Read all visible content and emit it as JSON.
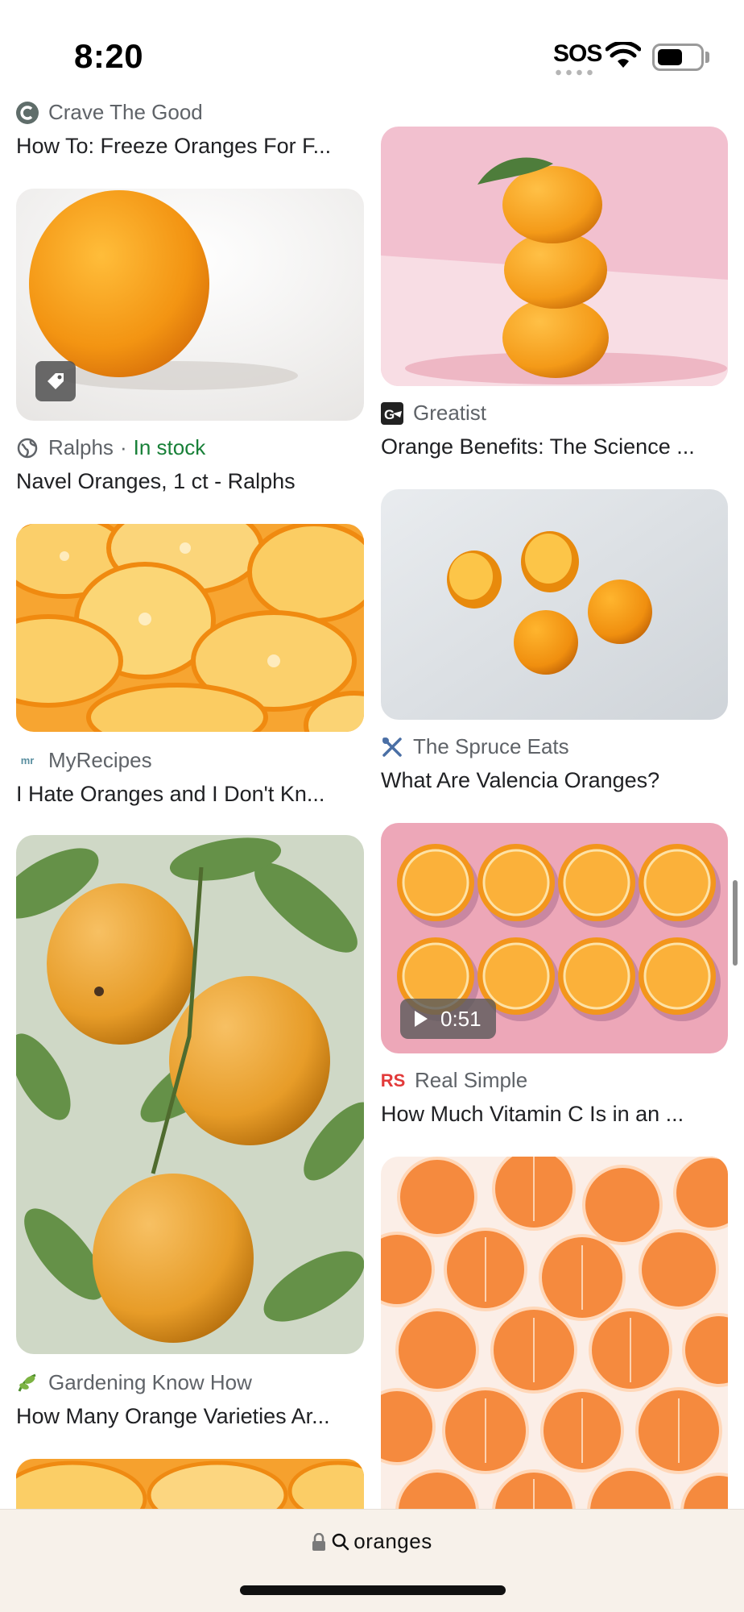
{
  "status_bar": {
    "time": "8:20",
    "sos": "SOS",
    "wifi_icon": "wifi-icon",
    "battery_icon": "battery-icon"
  },
  "results": {
    "left": [
      {
        "source": "Crave The Good",
        "title": "How To: Freeze Oranges For F...",
        "icon": "crave-the-good-logo"
      },
      {
        "source": "Ralphs",
        "separator": "·",
        "stock": "In stock",
        "title": "Navel Oranges, 1 ct - Ralphs",
        "icon": "globe-icon",
        "badge_icon": "tag-icon"
      },
      {
        "source": "MyRecipes",
        "title": "I Hate Oranges and I Don't Kn...",
        "icon": "myrecipes-logo"
      },
      {
        "source": "Gardening Know How",
        "title": "How Many Orange Varieties Ar...",
        "icon": "gardening-know-how-logo"
      }
    ],
    "right": [
      {
        "source": "Greatist",
        "title": "Orange Benefits: The Science ...",
        "icon": "greatist-logo"
      },
      {
        "source": "The Spruce Eats",
        "title": "What Are Valencia Oranges?",
        "icon": "spruce-eats-logo"
      },
      {
        "source": "Real Simple",
        "title": "How Much Vitamin C Is in an ...",
        "icon": "real-simple-logo",
        "logo_text": "RS",
        "video_duration": "0:51",
        "video_icon": "play-icon"
      }
    ]
  },
  "address_bar": {
    "query": "oranges",
    "lock_icon": "lock-icon",
    "search_icon": "search-icon"
  },
  "colors": {
    "in_stock": "#188038",
    "bottom_bar_bg": "#f7f1ea",
    "orange": "#f39a1e",
    "real_simple_red": "#e23a3a"
  }
}
